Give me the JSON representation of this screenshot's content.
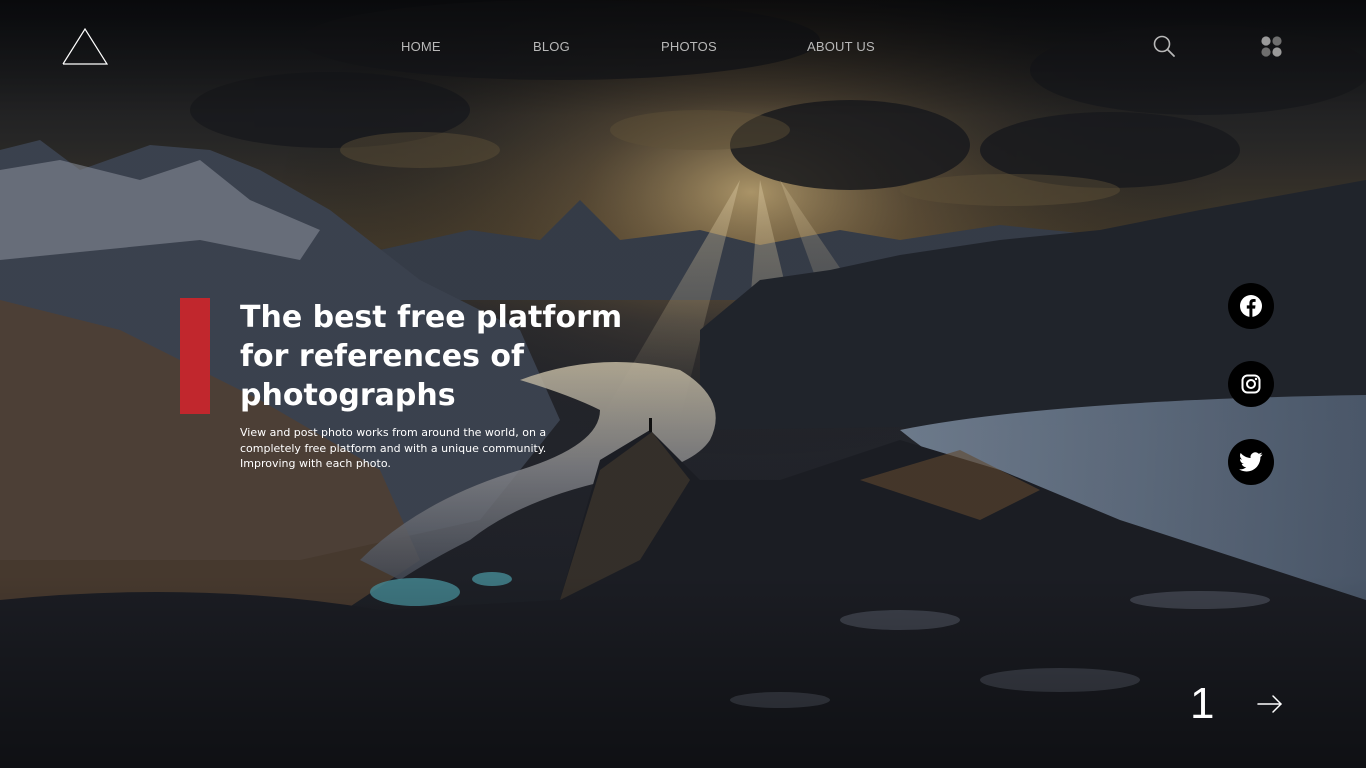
{
  "theme": {
    "accent": "#c1272d",
    "text": "#ffffff",
    "nav_text": "#b8b8b8",
    "social_bg": "#000000"
  },
  "header": {
    "logo": "triangle-logo",
    "nav": [
      {
        "label": "HOME"
      },
      {
        "label": "BLOG"
      },
      {
        "label": "PHOTOS"
      },
      {
        "label": "ABOUT US"
      }
    ],
    "icons": [
      "search-icon",
      "apps-grid-icon"
    ]
  },
  "hero": {
    "title": "The best free platform for references of photographs",
    "subtitle": "View and post photo works from around the world, on a completely free platform and with a unique community. Improving with each photo."
  },
  "social": [
    {
      "icon": "facebook-icon"
    },
    {
      "icon": "instagram-icon"
    },
    {
      "icon": "twitter-icon"
    }
  ],
  "pager": {
    "current": "1",
    "next_icon": "arrow-right-icon"
  }
}
